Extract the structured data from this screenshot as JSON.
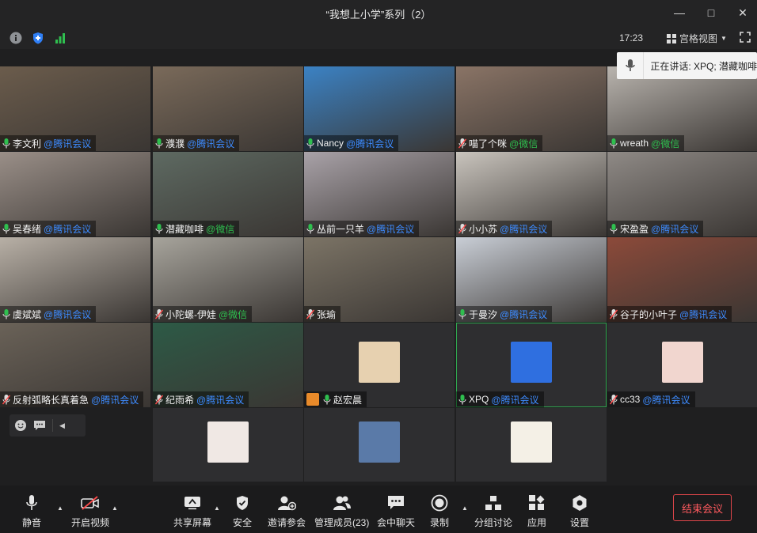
{
  "window": {
    "title": "“我想上小学”系列（2）"
  },
  "info": {
    "time": "17:23",
    "view_label": "宫格视图"
  },
  "speaking": {
    "text": "正在讲话: XPQ; 潜藏咖啡"
  },
  "participants": [
    {
      "name": "李文利",
      "tag": "@腾讯会议",
      "tagtype": "tx",
      "muted": false,
      "bg": "#6b5c4c"
    },
    {
      "name": "濮濮",
      "tag": "@腾讯会议",
      "tagtype": "tx",
      "muted": false,
      "bg": "#7a6a5a"
    },
    {
      "name": "Nancy",
      "tag": "@腾讯会议",
      "tagtype": "tx",
      "muted": false,
      "bg": "#3b82c4"
    },
    {
      "name": "喵了个咪",
      "tag": "@微信",
      "tagtype": "wx",
      "muted": true,
      "bg": "#8a7466"
    },
    {
      "name": "wreath",
      "tag": "@微信",
      "tagtype": "wx",
      "muted": false,
      "bg": "#b9b4ae"
    },
    {
      "name": "吴春绪",
      "tag": "@腾讯会议",
      "tagtype": "tx",
      "muted": false,
      "bg": "#9a8f88"
    },
    {
      "name": "潜藏咖啡",
      "tag": "@微信",
      "tagtype": "wx",
      "muted": false,
      "bg": "#5e6a62"
    },
    {
      "name": "丛前一只羊",
      "tag": "@腾讯会议",
      "tagtype": "tx",
      "muted": false,
      "bg": "#a9a2a8"
    },
    {
      "name": "小小苏",
      "tag": "@腾讯会议",
      "tagtype": "tx",
      "muted": true,
      "bg": "#c9c4bd"
    },
    {
      "name": "宋盈盈",
      "tag": "@腾讯会议",
      "tagtype": "tx",
      "muted": false,
      "bg": "#8f8a86"
    },
    {
      "name": "虞斌斌",
      "tag": "@腾讯会议",
      "tagtype": "tx",
      "muted": false,
      "bg": "#b8b0a6"
    },
    {
      "name": "小陀螺-伊娃",
      "tag": "@微信",
      "tagtype": "wx",
      "muted": true,
      "bg": "#a7a49c"
    },
    {
      "name": "张瑜",
      "tag": "",
      "tagtype": "tx",
      "muted": true,
      "bg": "#7c7466"
    },
    {
      "name": "于曼汐",
      "tag": "@腾讯会议",
      "tagtype": "tx",
      "muted": false,
      "bg": "#c9ced6"
    },
    {
      "name": "谷子的小叶子",
      "tag": "@腾讯会议",
      "tagtype": "tx",
      "muted": true,
      "bg": "#8c4a3a"
    },
    {
      "name": "反射弧略长真着急",
      "tag": "@腾讯会议",
      "tagtype": "tx",
      "muted": true,
      "bg": "#6a6258"
    },
    {
      "name": "纪雨希",
      "tag": "@腾讯会议",
      "tagtype": "tx",
      "muted": true,
      "bg": "#2d5a46"
    },
    {
      "name": "赵宏晨",
      "tag": "",
      "tagtype": "tx",
      "muted": false,
      "avatar": "#e7d1b0",
      "host": true
    },
    {
      "name": "XPQ",
      "tag": "@腾讯会议",
      "tagtype": "tx",
      "muted": false,
      "avatar": "#2f6fe0",
      "active": true
    },
    {
      "name": "cc33",
      "tag": "@腾讯会议",
      "tagtype": "tx",
      "muted": true,
      "avatar": "#f1d6cf"
    }
  ],
  "row5": [
    {
      "avatar": "#f0e8e4"
    },
    {
      "avatar": "#5a7aa8"
    },
    {
      "avatar": "#f4f0e6"
    }
  ],
  "toolbar": {
    "mute": "静音",
    "video": "开启视频",
    "share": "共享屏幕",
    "security": "安全",
    "invite": "邀请参会",
    "members": "管理成员(23)",
    "chat": "会中聊天",
    "record": "录制",
    "breakout": "分组讨论",
    "apps": "应用",
    "settings": "设置",
    "end": "结束会议"
  }
}
